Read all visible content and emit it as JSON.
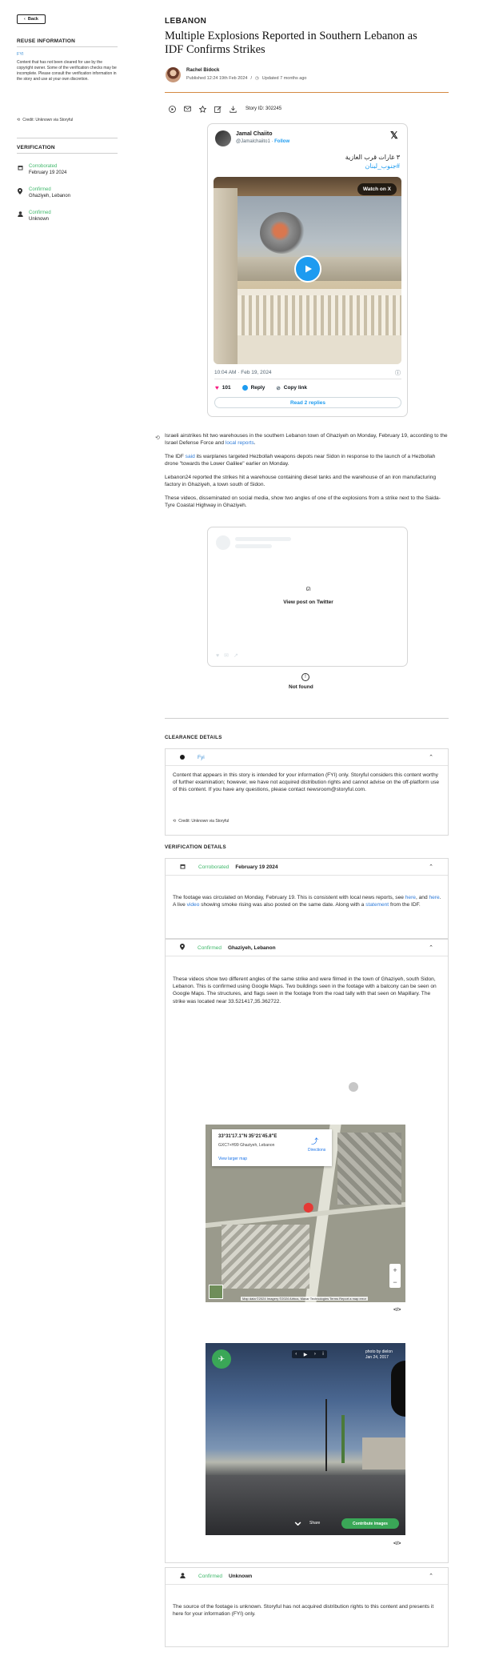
{
  "nav": {
    "back_label": "Back"
  },
  "reuse": {
    "title": "REUSE INFORMATION",
    "fyi_label": "FYI",
    "text": "Content that has not been cleared for use by the copyright owner. Some of the verification checks may be incomplete. Please consult the verification information in the story and use at your own discretion.",
    "credit": "Credit: Unknown via Storyful"
  },
  "verification_sidebar": {
    "title": "VERIFICATION",
    "items": [
      {
        "icon": "calendar-icon",
        "status": "Corroborated",
        "value": "February 19 2024"
      },
      {
        "icon": "location-pin-icon",
        "status": "Confirmed",
        "value": "Ghazіyeh, Lebanon"
      },
      {
        "icon": "person-icon",
        "status": "Confirmed",
        "value": "Unknown"
      }
    ]
  },
  "article": {
    "category": "LEBANON",
    "headline": "Multiple Explosions Reported in Southern Lebanon as IDF Confirms Strikes",
    "author": "Rachel Bidock",
    "published": "Published 12:24 19th Feb 2024",
    "updated": "Updated 7 months ago",
    "story_id": "Story ID: 302245"
  },
  "tweet": {
    "name": "Jamal Chaiito",
    "handle": "@Jamalchaiito1",
    "follow": "Follow",
    "text_line1": "٣ غارات قرب الغازية",
    "text_line2": "#جنوب_لبنان",
    "watch_label": "Watch on X",
    "timestamp": "10:04 AM · Feb 19, 2024",
    "likes": "101",
    "reply_label": "Reply",
    "copy_label": "Copy link",
    "replies_button": "Read 2 replies"
  },
  "body": {
    "p1_a": "Israeli airstrikes hit two warehouses in the southern Lebanon town of Ghaziyeh on Monday, February 19, according to the Israel Defense Force and ",
    "p1_link": "local reports",
    "p1_b": ".",
    "p2_a": "The IDF ",
    "p2_link": "said",
    "p2_b": " its warplanes targeted Hezbollah weapons depots near Sidon in response to the launch of a Hezbollah drone \"towards the Lower Galilee\" earlier on Monday.",
    "p3": "Lebanon24 reported the strikes hit a warehouse containing diesel tanks and the warehouse of an iron manufacturing factory in Ghaziyeh, a town south of Sidon.",
    "p4": "These videos, disseminated on social media, show two angles of one of the explosions from a strike next to the Saida-Tyre Coastal Highway in Ghaziyeh."
  },
  "embed2": {
    "view_label": "View post on Twitter",
    "not_found": "Not found"
  },
  "clearance": {
    "title": "CLEARANCE DETAILS",
    "status": "Fyi",
    "body": "Content that appears in this story is intended for your information (FYI) only. Storyful considers this content worthy of further examination; however, we have not acquired distribution rights and cannot advise on the off-platform use of this content. If you have any questions, please contact newsroom@storyful.com.",
    "credit": "Credit: Unknown via Storyful"
  },
  "verification": {
    "title": "VERIFICATION DETAILS",
    "date_panel": {
      "status": "Corroborated",
      "value": "February 19 2024",
      "t1": "The footage was circulated on Monday, February 19. This is consistent with local news reports, see ",
      "l1": "here",
      "t2": ", and ",
      "l2": "here",
      "t3": ". A live ",
      "l3": "video",
      "t4": " showing smoke rising was also posted on the same date. Along with a ",
      "l4": "statement",
      "t5": " from the IDF."
    },
    "location_panel": {
      "status": "Confirmed",
      "value": "Ghazіyeh, Lebanon",
      "body": "These videos show two different angles of the same strike and were filmed in the town of Ghaziyeh, south Sidon, Lebanon. This is confirmed using Google Maps. Two buildings seen in the footage with a balcony can be seen on Google Maps. The structures, and flags seen in the footage from the road tally with that seen on Mapillary. The strike was located near 33.521417,35.362722."
    },
    "source_panel": {
      "status": "Confirmed",
      "value": "Unknown",
      "body": "The source of the footage is unknown. Storyful has not acquired distribution rights to this content and presents it here for your information (FYI) only."
    }
  },
  "map": {
    "coord": "33°31'17.1\"N 35°21'45.8\"E",
    "address": "GXC7+H99 Ghaziyeh, Lebanon",
    "directions": "Directions",
    "larger": "View larger map",
    "footer": "Map data ©2024 Imagery ©2024 Airbus, Maxar Technologies  Terms  Report a map error",
    "embed_code": "</>"
  },
  "streetview": {
    "photo_by": "photo by dielon",
    "photo_date": "Jan 24, 2017",
    "share": "Share",
    "contribute": "Contribute images",
    "embed_code": "</>"
  },
  "colors": {
    "accent_green": "#40b86b",
    "link_blue": "#2f7bd8",
    "rule_orange": "#d58a43"
  }
}
